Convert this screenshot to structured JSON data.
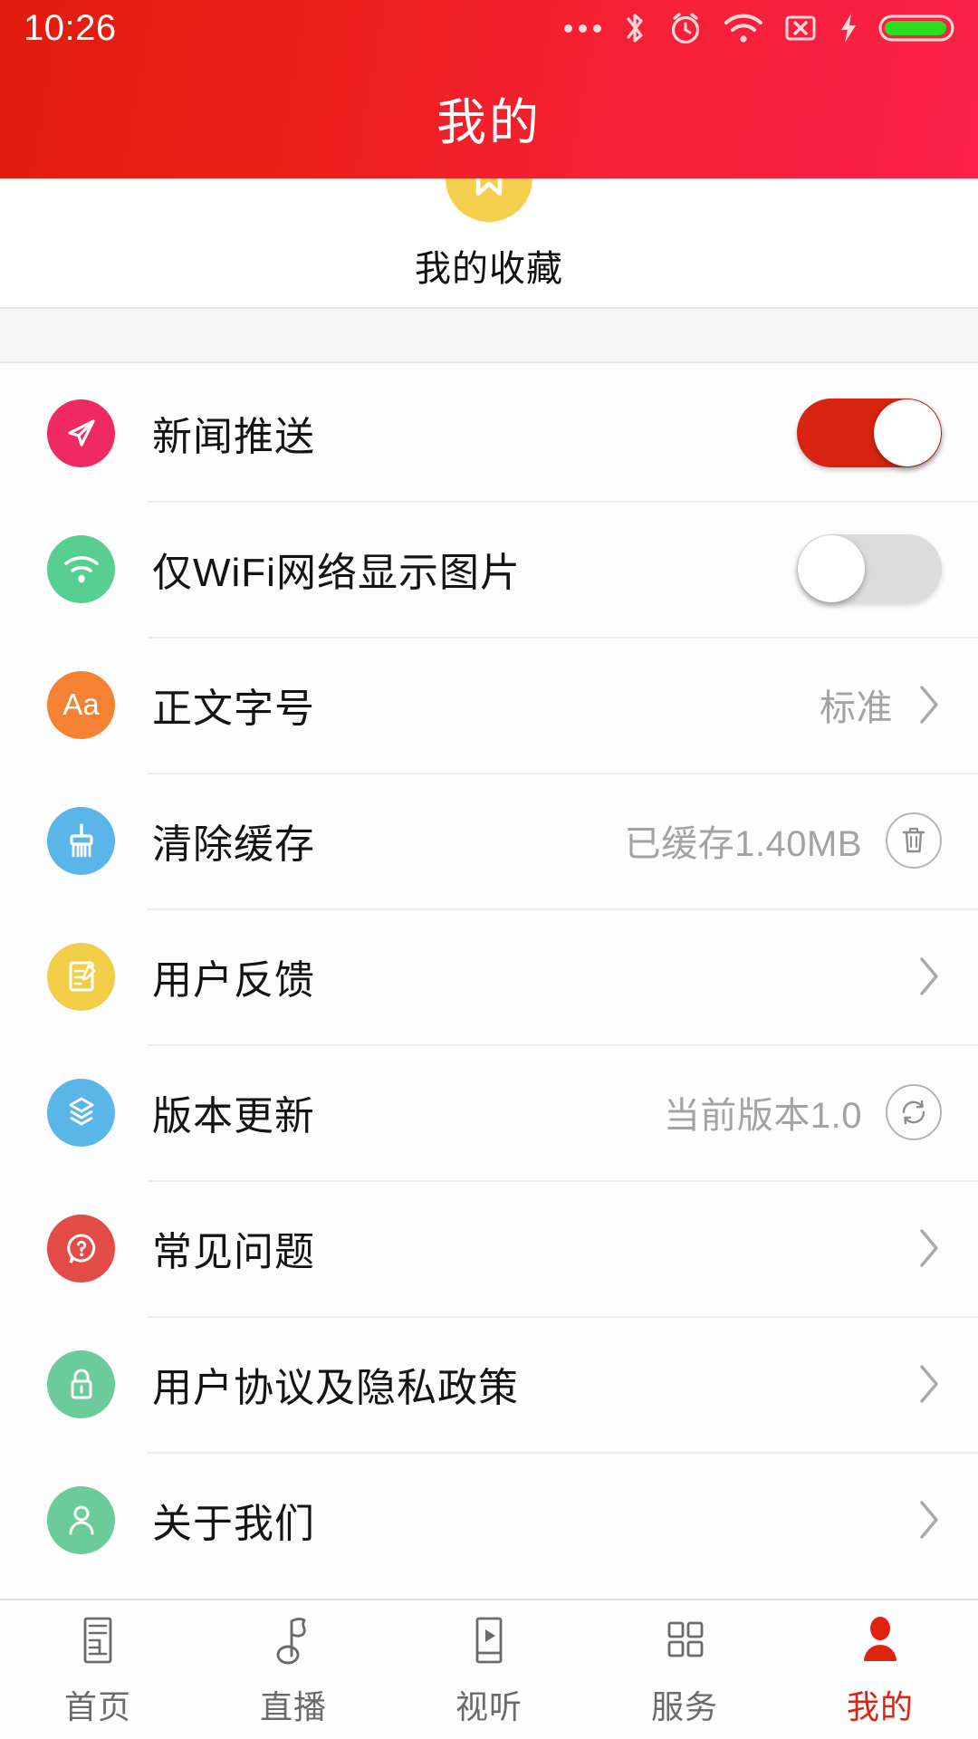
{
  "status_bar": {
    "time": "10:26",
    "icons": [
      "more-dots-icon",
      "bluetooth-icon",
      "alarm-clock-icon",
      "wifi-icon",
      "sim-card-off-icon",
      "charging-bolt-icon",
      "battery-icon"
    ]
  },
  "header": {
    "title": "我的",
    "gradient_from": "#e01c0d",
    "gradient_to": "#fb2148"
  },
  "favorites": {
    "label": "我的收藏",
    "icon": "bookmark-icon",
    "circle_color": "#f5cf4e"
  },
  "settings": {
    "rows": [
      {
        "label": "新闻推送",
        "icon": "paper-plane-icon",
        "icon_color": "#ef2a63",
        "control": "toggle",
        "toggle_on": true,
        "toggle_on_color": "#d62410"
      },
      {
        "label": "仅WiFi网络显示图片",
        "icon": "wifi-icon",
        "icon_color": "#56cf91",
        "control": "toggle",
        "toggle_on": false,
        "toggle_off_color": "#dcdcdc"
      },
      {
        "label": "正文字号",
        "icon": "font-size-icon",
        "icon_text": "Aa",
        "icon_color": "#f58232",
        "control": "value-chevron",
        "value": "标准"
      },
      {
        "label": "清除缓存",
        "icon": "broom-icon",
        "icon_color": "#5ab6e8",
        "control": "value-circle-button",
        "value": "已缓存1.40MB",
        "button_icon": "trash-icon"
      },
      {
        "label": "用户反馈",
        "icon": "feedback-form-icon",
        "icon_color": "#f2ce48",
        "control": "chevron"
      },
      {
        "label": "版本更新",
        "icon": "layers-icon",
        "icon_color": "#5ab6e8",
        "control": "value-circle-button",
        "value": "当前版本1.0",
        "button_icon": "refresh-icon"
      },
      {
        "label": "常见问题",
        "icon": "question-bubble-icon",
        "icon_color": "#e24b46",
        "control": "chevron"
      },
      {
        "label": "用户协议及隐私政策",
        "icon": "lock-icon",
        "icon_color": "#6ccb9a",
        "control": "chevron"
      },
      {
        "label": "关于我们",
        "icon": "person-icon",
        "icon_color": "#6ccb9a",
        "control": "chevron"
      }
    ]
  },
  "tabbar": {
    "active_color": "#e0230f",
    "inactive_color": "#6b6b6b",
    "tabs": [
      {
        "label": "首页",
        "icon": "news-page-icon",
        "active": false
      },
      {
        "label": "直播",
        "icon": "music-flag-icon",
        "active": false
      },
      {
        "label": "视听",
        "icon": "video-play-icon",
        "active": false
      },
      {
        "label": "服务",
        "icon": "grid-icon",
        "active": false
      },
      {
        "label": "我的",
        "icon": "person-icon",
        "active": true
      }
    ]
  }
}
